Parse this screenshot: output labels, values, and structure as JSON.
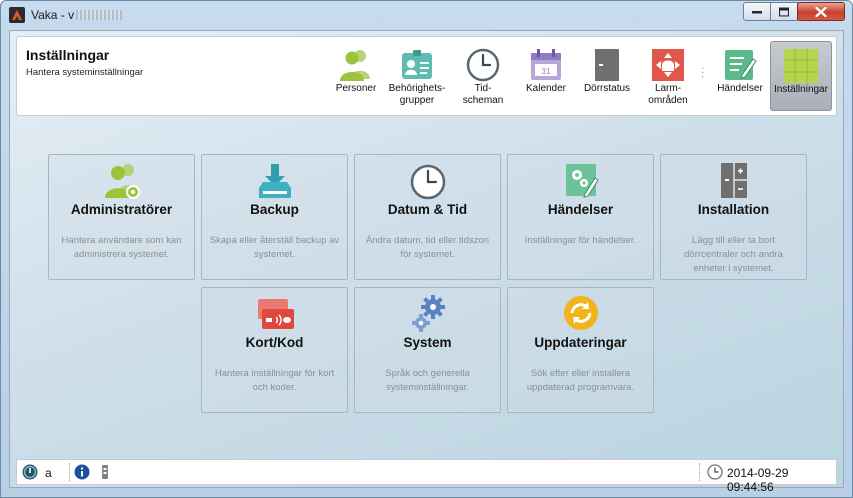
{
  "window": {
    "title": "Vaka - v",
    "minimize_label": "",
    "maximize_label": "",
    "close_label": ""
  },
  "header": {
    "title": "Inställningar",
    "subtitle": "Hantera systeminställningar"
  },
  "nav": [
    {
      "label": "Personer",
      "icon": "people-icon"
    },
    {
      "label": "Behörighets-\ngrupper",
      "icon": "id-card-icon"
    },
    {
      "label": "Tid-\nscheman",
      "icon": "clock-icon"
    },
    {
      "label": "Kalender",
      "icon": "calendar-icon"
    },
    {
      "label": "Dörrstatus",
      "icon": "door-icon"
    },
    {
      "label": "Larm-\nområden",
      "icon": "alarm-area-icon"
    },
    {
      "label": "Händelser",
      "icon": "events-icon"
    },
    {
      "label": "Inställningar",
      "icon": "settings-grid-icon",
      "active": true
    }
  ],
  "tiles": [
    {
      "title": "Administratörer",
      "desc": "Hantera användare som kan administrera systemet.",
      "icon": "admin-users-icon"
    },
    {
      "title": "Backup",
      "desc": "Skapa eller återställ backup av systemet.",
      "icon": "backup-icon"
    },
    {
      "title": "Datum & Tid",
      "desc": "Ändra datum, tid eller tidszon för systemet.",
      "icon": "clock-icon"
    },
    {
      "title": "Händelser",
      "desc": "Inställningar för händelser.",
      "icon": "event-settings-icon"
    },
    {
      "title": "Installation",
      "desc": "Lägg till eller ta bort dörrcentraler och andra enheter i systemet.",
      "icon": "installation-icon"
    },
    {
      "title": "Kort/Kod",
      "desc": "Hantera inställningar för kort och koder.",
      "icon": "card-code-icon"
    },
    {
      "title": "System",
      "desc": "Språk och generella systeminställningar.",
      "icon": "gears-icon"
    },
    {
      "title": "Uppdateringar",
      "desc": "Sök efter eller installera uppdaterad programvara.",
      "icon": "update-icon"
    }
  ],
  "status": {
    "user": "a",
    "datetime": "2014-09-29 09:44:56"
  },
  "colors": {
    "accent_green": "#9bc43a",
    "teal": "#3fa9a9",
    "card_red": "#e0473f",
    "update_yellow": "#f2b31b",
    "gear_blue": "#5b83c4"
  }
}
